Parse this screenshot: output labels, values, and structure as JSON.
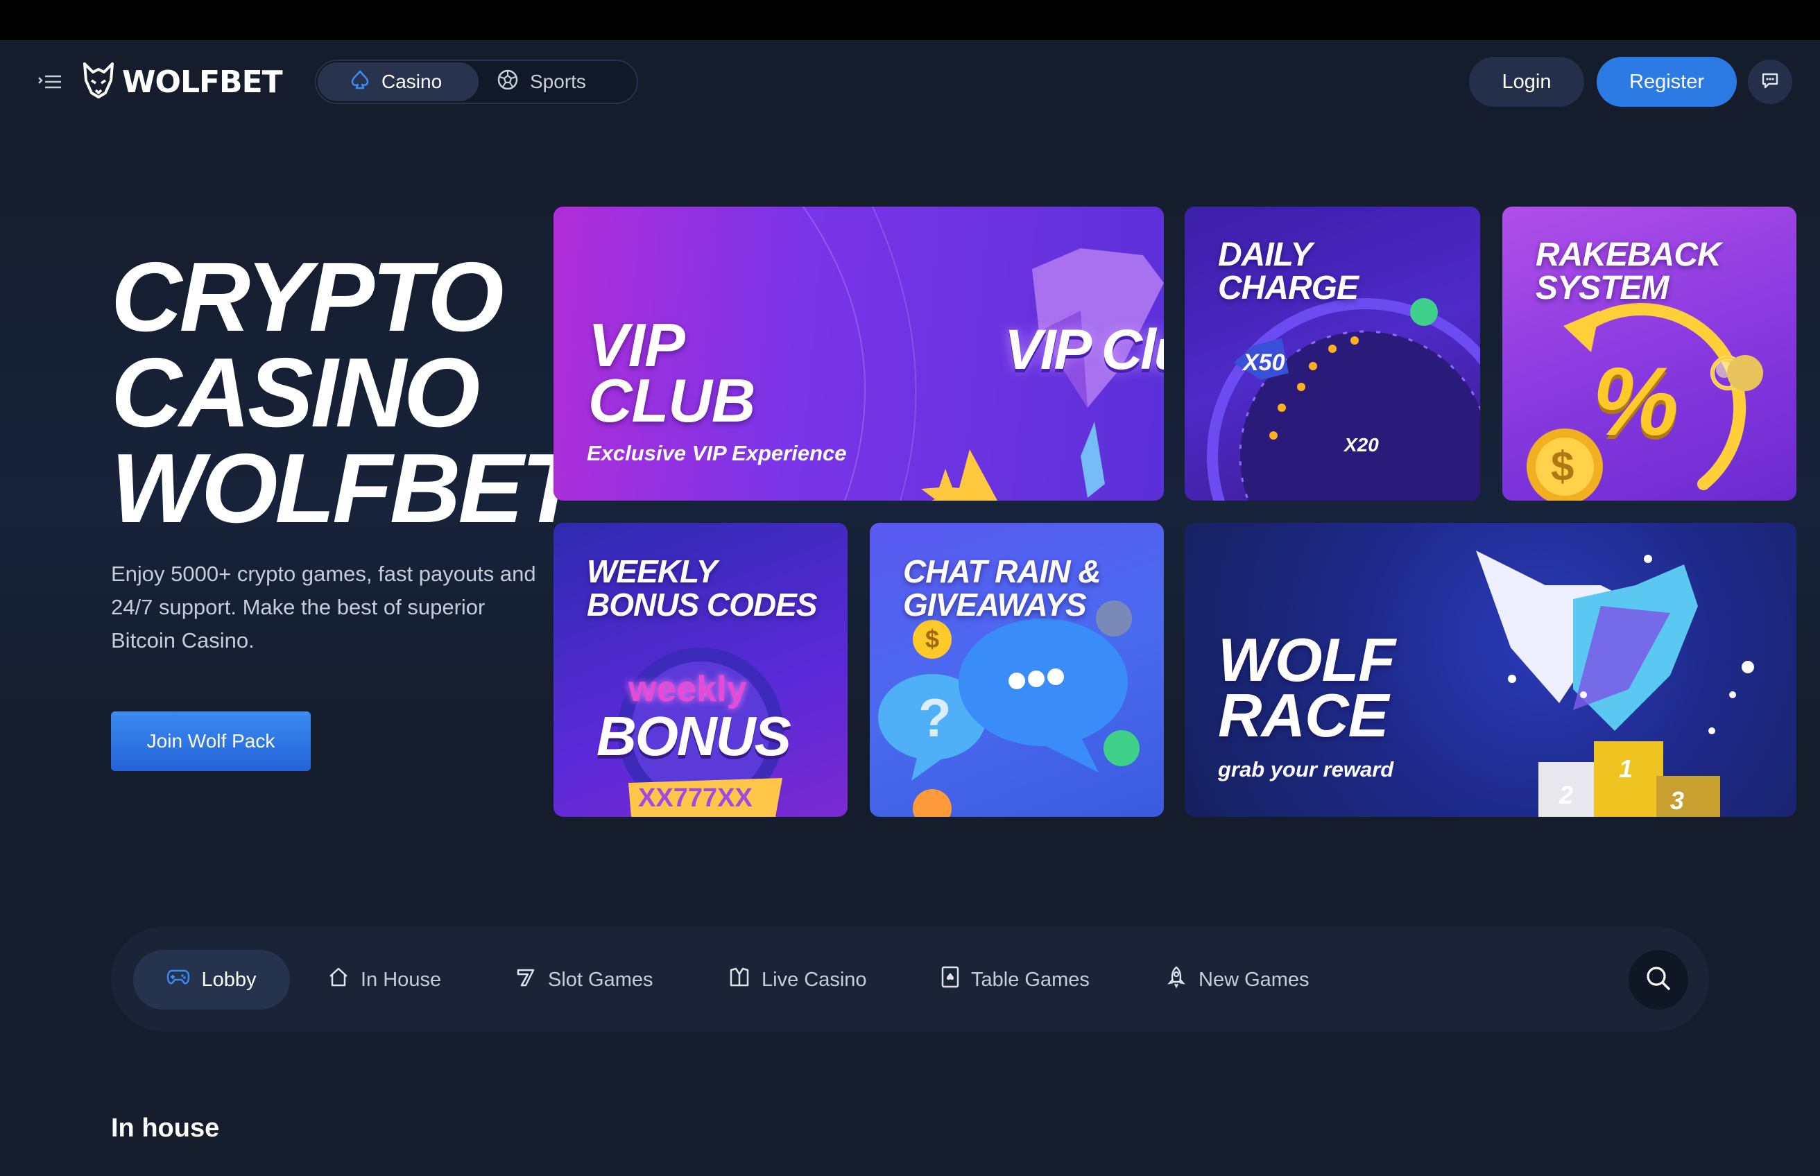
{
  "header": {
    "logo_text": "WOLFBET",
    "mode_tabs": [
      {
        "label": "Casino",
        "icon": "spade-icon",
        "active": true
      },
      {
        "label": "Sports",
        "icon": "soccer-ball-icon",
        "active": false
      }
    ],
    "login_label": "Login",
    "register_label": "Register",
    "accent_color": "#2c7be5"
  },
  "hero": {
    "title_lines": [
      "CRYPTO",
      "CASINO",
      "WOLFBET"
    ],
    "subtitle": "Enjoy 5000+ crypto games, fast payouts and 24/7 support. Make the best of superior Bitcoin Casino.",
    "cta_label": "Join Wolf Pack"
  },
  "promos": {
    "vip": {
      "title_lines": [
        "VIP",
        "CLUB"
      ],
      "subtitle": "Exclusive VIP Experience",
      "art_text": "VIP Clu"
    },
    "daily": {
      "title_lines": [
        "DAILY",
        "CHARGE"
      ],
      "badge_1": "X50",
      "badge_2": "X20"
    },
    "rakeback": {
      "title_lines": [
        "RAKEBACK",
        "SYSTEM"
      ],
      "symbol": "%",
      "coin": "$"
    },
    "weekly": {
      "title_lines": [
        "WEEKLY",
        "BONUS CODES"
      ],
      "art_top": "weekly",
      "art_main": "BONUS",
      "code": "XX777XX"
    },
    "chat": {
      "title_lines": [
        "CHAT RAIN &",
        "GIVEAWAYS"
      ],
      "coin": "$",
      "bubble": "?"
    },
    "wolf_race": {
      "title_lines": [
        "WOLF",
        "RACE"
      ],
      "subtitle": "grab your reward",
      "podium": [
        "2",
        "1",
        "3"
      ]
    }
  },
  "category_nav": {
    "items": [
      {
        "label": "Lobby",
        "icon": "gamepad-icon",
        "active": true
      },
      {
        "label": "In House",
        "icon": "house-icon",
        "active": false
      },
      {
        "label": "Slot Games",
        "icon": "seven-icon",
        "active": false
      },
      {
        "label": "Live Casino",
        "icon": "dealer-icon",
        "active": false
      },
      {
        "label": "Table Games",
        "icon": "card-icon",
        "active": false
      },
      {
        "label": "New Games",
        "icon": "rocket-icon",
        "active": false
      }
    ],
    "search_icon": "search-icon"
  },
  "sections": {
    "in_house_title": "In house"
  }
}
